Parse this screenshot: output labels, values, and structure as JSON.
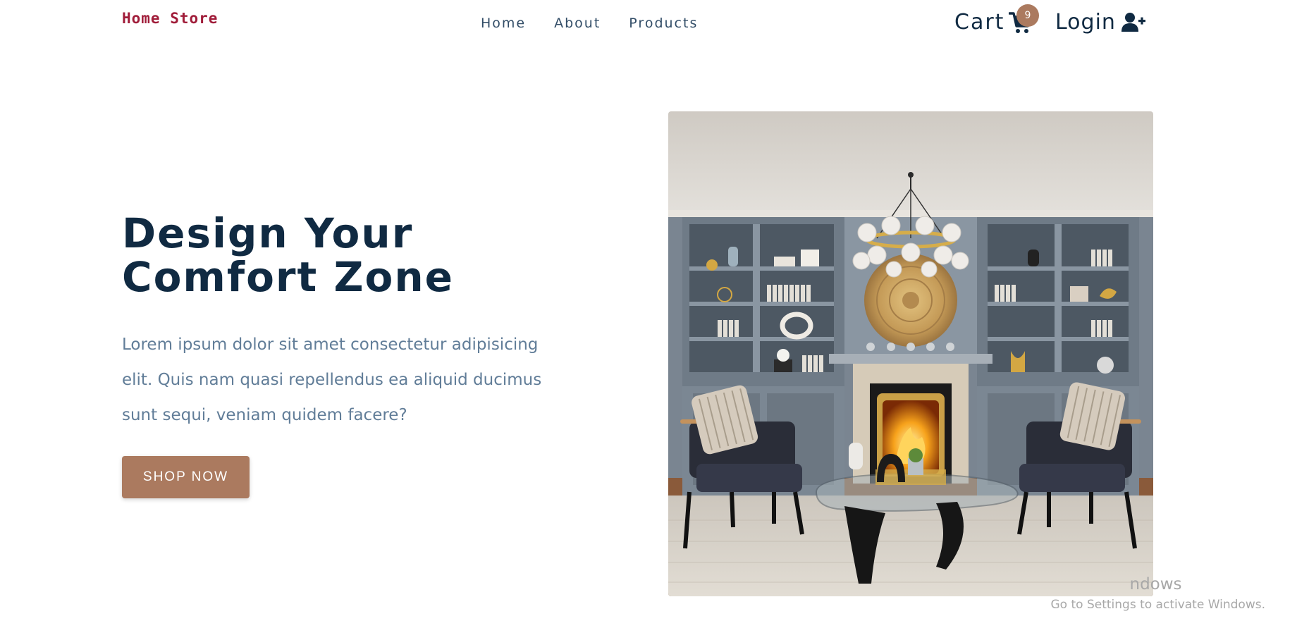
{
  "navbar": {
    "logo": "Home Store",
    "links": [
      {
        "label": "Home"
      },
      {
        "label": "About"
      },
      {
        "label": "Products"
      }
    ],
    "cart_label": "Cart",
    "cart_count": "9",
    "login_label": "Login"
  },
  "hero": {
    "title_line1": "Design Your",
    "title_line2": "Comfort Zone",
    "text": "Lorem ipsum dolor sit amet consectetur adipisicing elit. Quis nam quasi repellendus ea aliquid ducimus sunt sequi, veniam quidem facere?",
    "button_label": "SHOP NOW"
  },
  "watermark": {
    "line1": "ndows",
    "line2": "Go to Settings to activate Windows."
  },
  "colors": {
    "primary_dark": "#102a42",
    "accent": "#ab7a5f",
    "logo": "#a01c39",
    "text_muted": "#617d98"
  }
}
